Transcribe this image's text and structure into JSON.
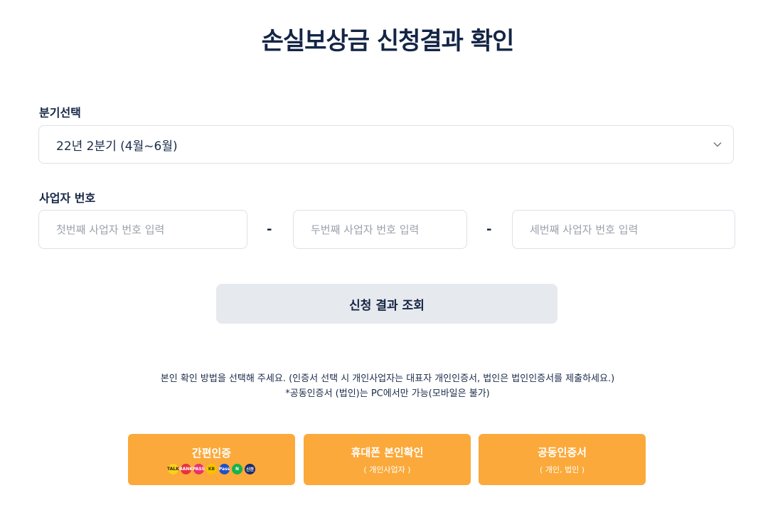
{
  "page": {
    "title": "손실보상금 신청결과 확인"
  },
  "quarter": {
    "label": "분기선택",
    "selected": "22년 2분기 (4월~6월)"
  },
  "business_number": {
    "label": "사업자 번호",
    "first_placeholder": "첫번째 사업자 번호 입력",
    "second_placeholder": "두번째 사업자 번호 입력",
    "third_placeholder": "세번째 사업자 번호 입력",
    "separator": "-"
  },
  "query_button": {
    "label": "신청 결과 조회"
  },
  "notice": {
    "line1": "본인 확인 방법을 선택해 주세요. (인증서 선택 시 개인사업자는 대표자 개인인증서, 법인은 법인인증서를 제출하세요.)",
    "line2": "*공동인증서 (법인)는 PC에서만 가능(모바일은 불가)"
  },
  "auth_buttons": [
    {
      "label": "간편인증",
      "providers": [
        {
          "name": "kakao",
          "text": "TALK",
          "color": "#f7d21a",
          "text_color": "#3b1e1e"
        },
        {
          "name": "samsung",
          "text": "BANK",
          "color": "#e8323c",
          "text_color": "#ffffff"
        },
        {
          "name": "pass",
          "text": "PASS",
          "color": "#e8326e",
          "text_color": "#ffffff"
        },
        {
          "name": "kb",
          "text": "KB",
          "color": "#f5c400",
          "text_color": "#4a3b00"
        },
        {
          "name": "payco",
          "text": "Pass",
          "color": "#1e50c8",
          "text_color": "#ffffff"
        },
        {
          "name": "naver",
          "text": "N",
          "color": "#19b24a",
          "text_color": "#ffffff"
        },
        {
          "name": "shinhan",
          "text": "신한",
          "color": "#1c2d6b",
          "text_color": "#ffffff"
        }
      ]
    },
    {
      "label": "휴대폰 본인확인",
      "sub": "( 개인사업자 )"
    },
    {
      "label": "공동인증서",
      "sub": "( 개인, 법인 )"
    }
  ],
  "colors": {
    "title": "#142545",
    "auth_button_bg": "#fba93a",
    "query_button_bg": "#e6e9ed",
    "border": "#dde1e7"
  }
}
